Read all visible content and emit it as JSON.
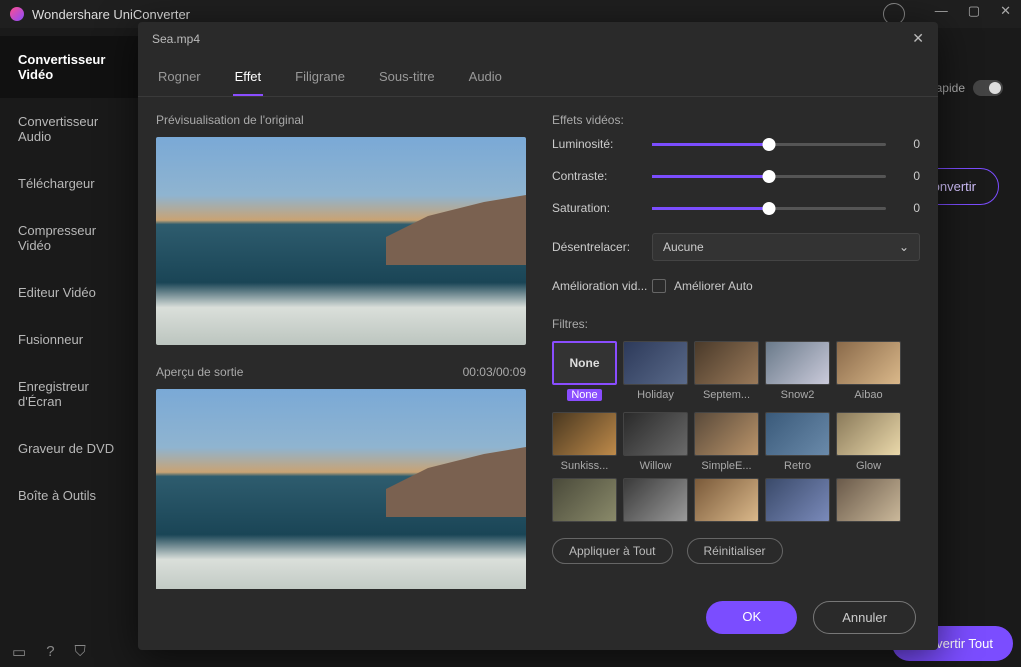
{
  "app": {
    "title": "Wondershare UniConverter"
  },
  "window_controls": {
    "min": "—",
    "max": "▢",
    "close": "✕"
  },
  "sidebar": {
    "items": [
      {
        "label": "Convertisseur Vidéo"
      },
      {
        "label": "Convertisseur Audio"
      },
      {
        "label": "Téléchargeur"
      },
      {
        "label": "Compresseur Vidéo"
      },
      {
        "label": "Editeur Vidéo"
      },
      {
        "label": "Fusionneur"
      },
      {
        "label": "Enregistreur d'Écran"
      },
      {
        "label": "Graveur de DVD"
      },
      {
        "label": "Boîte à Outils"
      }
    ]
  },
  "main": {
    "fast_label": "rapide",
    "convert_button": "Convertir",
    "convert_all": "Convertir Tout"
  },
  "modal": {
    "filename": "Sea.mp4",
    "tabs": [
      {
        "label": "Rogner"
      },
      {
        "label": "Effet"
      },
      {
        "label": "Filigrane"
      },
      {
        "label": "Sous-titre"
      },
      {
        "label": "Audio"
      }
    ],
    "active_tab": 1,
    "preview_original": "Prévisualisation de l'original",
    "preview_output": "Aperçu de sortie",
    "time_current": "00:03",
    "time_total": "00:09",
    "effects_label": "Effets vidéos:",
    "controls": {
      "brightness": {
        "label": "Luminosité:",
        "value": "0"
      },
      "contrast": {
        "label": "Contraste:",
        "value": "0"
      },
      "saturation": {
        "label": "Saturation:",
        "value": "0"
      },
      "deinterlace": {
        "label": "Désentrelacer:",
        "value": "Aucune"
      },
      "enhance": {
        "label": "Amélioration vid...",
        "checkbox": "Améliorer Auto"
      }
    },
    "filters_label": "Filtres:",
    "filters": [
      {
        "name": "None"
      },
      {
        "name": "Holiday"
      },
      {
        "name": "Septem..."
      },
      {
        "name": "Snow2"
      },
      {
        "name": "Aibao"
      },
      {
        "name": "Sunkiss..."
      },
      {
        "name": "Willow"
      },
      {
        "name": "SimpleE..."
      },
      {
        "name": "Retro"
      },
      {
        "name": "Glow"
      },
      {
        "name": ""
      },
      {
        "name": ""
      },
      {
        "name": ""
      },
      {
        "name": ""
      },
      {
        "name": ""
      }
    ],
    "apply_all": "Appliquer à Tout",
    "reset": "Réinitialiser",
    "ok": "OK",
    "cancel": "Annuler"
  }
}
